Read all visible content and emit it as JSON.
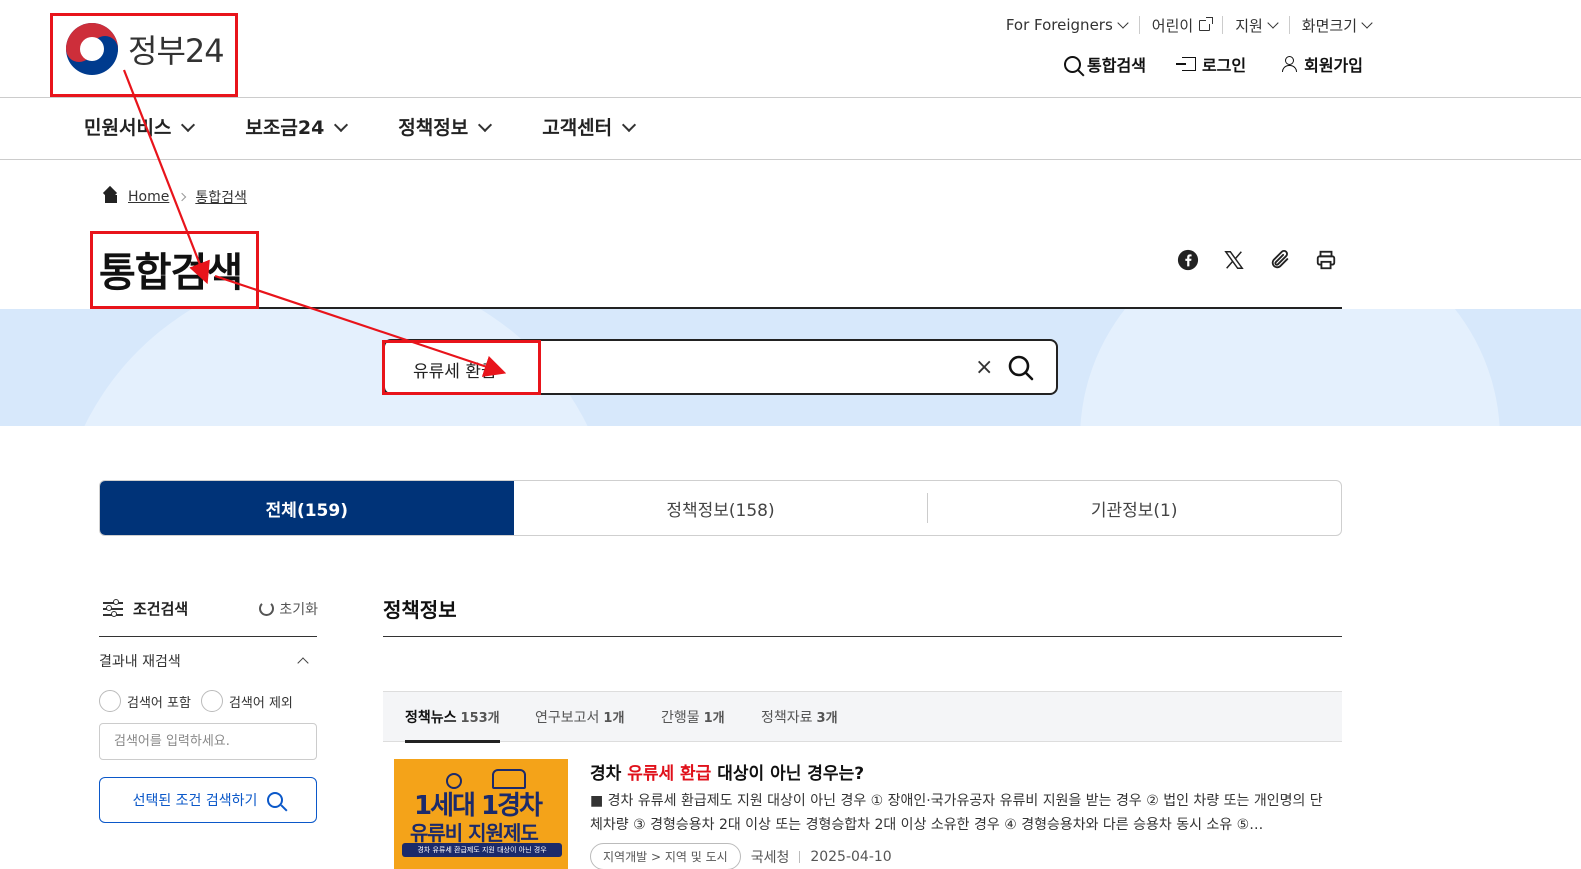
{
  "header": {
    "logo_text": "정부24",
    "util": [
      "For Foreigners",
      "어린이",
      "지원",
      "화면크기"
    ],
    "quick": {
      "search": "통합검색",
      "login": "로그인",
      "signup": "회원가입"
    }
  },
  "gnb": [
    "민원서비스",
    "보조금24",
    "정책정보",
    "고객센터"
  ],
  "breadcrumb": {
    "home": "Home",
    "current": "통합검색"
  },
  "page_title": "통합검색",
  "search": {
    "value": "유류세 환급",
    "clear": "×"
  },
  "tabs": [
    {
      "label": "전체(159)"
    },
    {
      "label": "정책정보(158)"
    },
    {
      "label": "기관정보(1)"
    }
  ],
  "filter": {
    "title": "조건검색",
    "reset": "초기화",
    "within": "결과내 재검색",
    "include": "검색어 포함",
    "exclude": "검색어 제외",
    "placeholder": "검색어를 입력하세요.",
    "button": "선택된 조건 검색하기"
  },
  "section_title": "정책정보",
  "subtabs": [
    {
      "label": "정책뉴스",
      "count": "153개"
    },
    {
      "label": "연구보고서",
      "count": "1개"
    },
    {
      "label": "간행물",
      "count": "1개"
    },
    {
      "label": "정책자료",
      "count": "3개"
    }
  ],
  "result": {
    "title_pre": "경차 ",
    "title_hl": "유류세 환급",
    "title_post": " 대상이 아닌 경우는?",
    "body": "■ 경차 유류세 환급제도 지원 대상이 아닌 경우 ① 장애인·국가유공자 유류비 지원을 받는 경우 ② 법인 차량 또는 개인명의 단체차량 ③ 경형승용차 2대 이상 또는 경형승합차 2대 이상 소유한 경우 ④ 경형승용차와 다른 승용차 동시 소유 ⑤…",
    "tag": "지역개발 > 지역 및 도시",
    "agency": "국세청",
    "date": "2025-04-10",
    "thumb": {
      "line1": "1세대 1경차",
      "line2": "유류비 지원제도",
      "line3": "경차 유류세 환급제도 지원 대상이 아닌 경우"
    }
  }
}
